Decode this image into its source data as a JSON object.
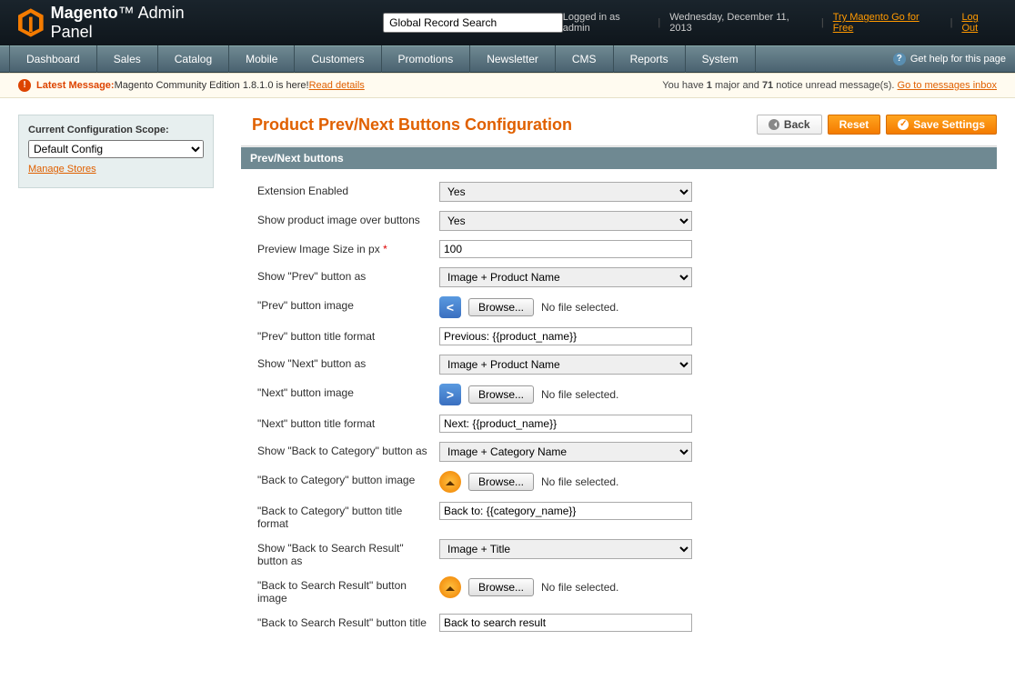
{
  "header": {
    "brand_main": "Magento",
    "brand_sub": "Admin Panel",
    "search_placeholder": "Global Record Search",
    "logged_in": "Logged in as admin",
    "date": "Wednesday, December 11, 2013",
    "try_link": "Try Magento Go for Free",
    "logout": "Log Out"
  },
  "nav": {
    "items": [
      "Dashboard",
      "Sales",
      "Catalog",
      "Mobile",
      "Customers",
      "Promotions",
      "Newsletter",
      "CMS",
      "Reports",
      "System"
    ],
    "help": "Get help for this page"
  },
  "msg": {
    "label": "Latest Message:",
    "text": " Magento Community Edition 1.8.1.0 is here! ",
    "read": "Read details",
    "right_1": "You have ",
    "right_major": "1",
    "right_2": " major and ",
    "right_notice": "71",
    "right_3": " notice unread message(s). ",
    "gotolink": "Go to messages inbox"
  },
  "sidebar": {
    "title": "Current Configuration Scope:",
    "selected": "Default Config",
    "manage": "Manage Stores"
  },
  "page": {
    "title": "Product Prev/Next Buttons Configuration",
    "back": "Back",
    "reset": "Reset",
    "save": "Save Settings"
  },
  "section": {
    "title": "Prev/Next buttons"
  },
  "form": {
    "ext_enabled_label": "Extension Enabled",
    "ext_enabled_value": "Yes",
    "show_img_label": "Show product image over buttons",
    "show_img_value": "Yes",
    "preview_size_label": "Preview Image Size in px",
    "preview_size_value": "100",
    "show_prev_label": "Show \"Prev\" button as",
    "show_prev_value": "Image + Product Name",
    "prev_img_label": "\"Prev\" button image",
    "prev_title_label": "\"Prev\" button title format",
    "prev_title_value": "Previous: {{product_name}}",
    "show_next_label": "Show \"Next\" button as",
    "show_next_value": "Image + Product Name",
    "next_img_label": "\"Next\" button image",
    "next_title_label": "\"Next\" button title format",
    "next_title_value": "Next: {{product_name}}",
    "show_back_cat_label": "Show \"Back to Category\" button as",
    "show_back_cat_value": "Image + Category Name",
    "back_cat_img_label": "\"Back to Category\" button image",
    "back_cat_title_label": "\"Back to Category\" button title format",
    "back_cat_title_value": "Back to: {{category_name}}",
    "show_back_search_label": "Show \"Back to Search Result\" button as",
    "show_back_search_value": "Image + Title",
    "back_search_img_label": "\"Back to Search Result\" button image",
    "back_search_title_label": "\"Back to Search Result\" button title",
    "back_search_title_value": "Back to search result",
    "browse": "Browse...",
    "no_file": "No file selected."
  }
}
